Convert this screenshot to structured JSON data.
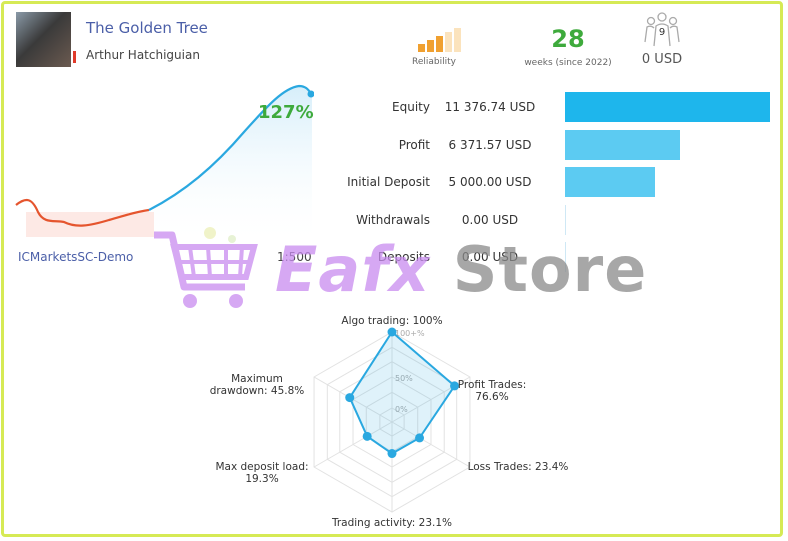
{
  "signal": {
    "title": "The Golden Tree",
    "author": "Arthur Hatchiguian",
    "reliability_label": "Reliability",
    "reliability_level": 3,
    "reliability_max": 5,
    "weeks": "28",
    "weeks_label": "weeks (since 2022)",
    "subscribers_count": "9",
    "subscription_price": "0 USD"
  },
  "growth": {
    "value": "127%",
    "broker": "ICMarketsSC-Demo",
    "leverage": "1:500"
  },
  "stats": [
    {
      "label": "Equity",
      "value": "11 376.74 USD",
      "amount": 11376.74,
      "color": "#1eb6ec"
    },
    {
      "label": "Profit",
      "value": "6 371.57 USD",
      "amount": 6371.57,
      "color": "#5ccbf2"
    },
    {
      "label": "Initial Deposit",
      "value": "5 000.00 USD",
      "amount": 5000.0,
      "color": "#5ccbf2"
    },
    {
      "label": "Withdrawals",
      "value": "0.00 USD",
      "amount": 0,
      "color": "#5ccbf2"
    },
    {
      "label": "Deposits",
      "value": "0.00 USD",
      "amount": 0,
      "color": "#5ccbf2"
    }
  ],
  "chart_data": {
    "type": "radar",
    "ring_labels": [
      "100+%",
      "50%",
      "0%"
    ],
    "axes": [
      {
        "label": "Algo trading: 100%",
        "value": 100
      },
      {
        "label": "Profit Trades: 76.6%",
        "value": 76.6
      },
      {
        "label": "Loss Trades: 23.4%",
        "value": 23.4
      },
      {
        "label": "Trading activity: 23.1%",
        "value": 23.1
      },
      {
        "label": "Max deposit load: 19.3%",
        "value": 19.3
      },
      {
        "label": "Maximum drawdown: 45.8%",
        "value": 45.8
      }
    ],
    "color": "#2aa8e0"
  },
  "watermark": {
    "text": "Eafx Store"
  }
}
